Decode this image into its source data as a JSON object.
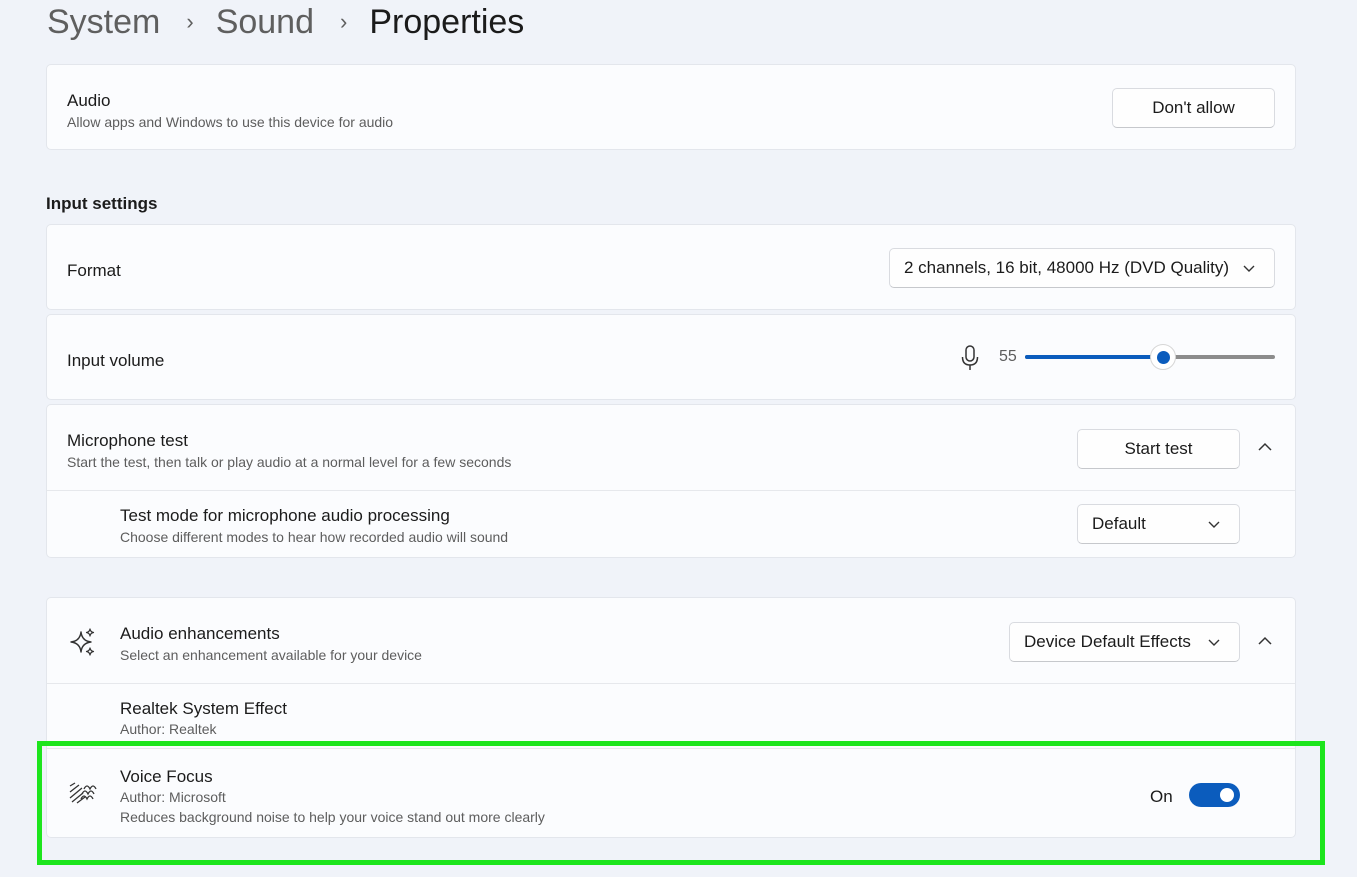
{
  "breadcrumb": {
    "item1": "System",
    "item2": "Sound",
    "current": "Properties",
    "separator": "›"
  },
  "audio": {
    "title": "Audio",
    "subtitle": "Allow apps and Windows to use this device for audio",
    "button": "Don't allow"
  },
  "input_settings": {
    "heading": "Input settings",
    "format": {
      "label": "Format",
      "value": "2 channels, 16 bit, 48000 Hz (DVD Quality)"
    },
    "volume": {
      "label": "Input volume",
      "value": "55",
      "fraction": 0.55
    },
    "mic_test": {
      "title": "Microphone test",
      "subtitle": "Start the test, then talk or play audio at a normal level for a few seconds",
      "button": "Start test",
      "test_mode": {
        "title": "Test mode for microphone audio processing",
        "subtitle": "Choose different modes to hear how recorded audio will sound",
        "value": "Default"
      }
    }
  },
  "enhancements": {
    "title": "Audio enhancements",
    "subtitle": "Select an enhancement available for your device",
    "value": "Device Default Effects",
    "items": [
      {
        "title": "Realtek System Effect",
        "author": "Author: Realtek"
      },
      {
        "title": "Voice Focus",
        "author": "Author: Microsoft",
        "description": "Reduces background noise to help your voice stand out more clearly",
        "state": "On"
      }
    ]
  },
  "colors": {
    "accent": "#0b5cbd",
    "highlight": "#1de51d"
  },
  "icons": {
    "mic": "microphone-icon",
    "sparkle": "sparkle-icon",
    "voice_focus": "voice-focus-icon",
    "chevron_up": "chevron-up-icon",
    "chevron_down": "chevron-down-icon"
  }
}
